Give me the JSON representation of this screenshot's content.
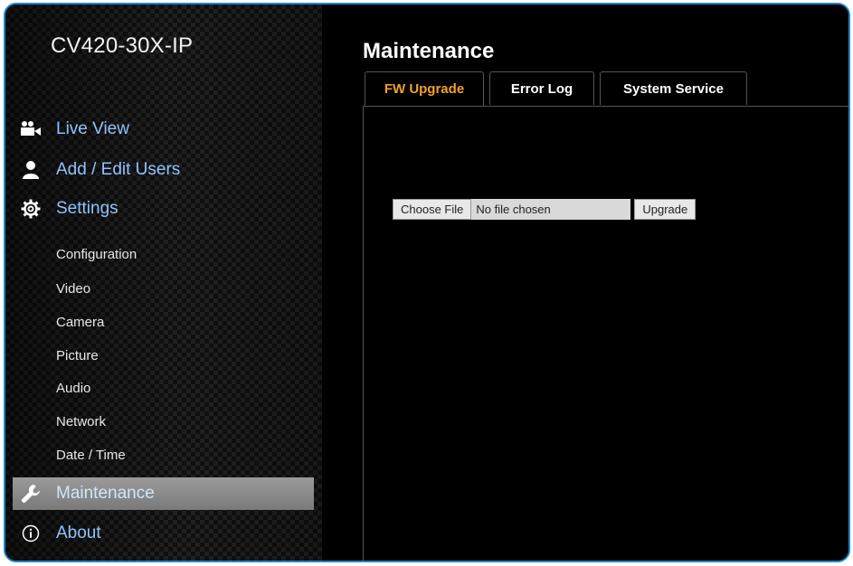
{
  "sidebar": {
    "device_name": "CV420-30X-IP",
    "main_items": [
      {
        "label": "Live View",
        "icon": "video-camera-icon"
      },
      {
        "label": "Add / Edit Users",
        "icon": "user-icon"
      },
      {
        "label": "Settings",
        "icon": "gear-icon"
      },
      {
        "label": "Maintenance",
        "icon": "wrench-icon",
        "active": true
      },
      {
        "label": "About",
        "icon": "info-icon"
      }
    ],
    "settings_items": [
      "Configuration",
      "Video",
      "Camera",
      "Picture",
      "Audio",
      "Network",
      "Date / Time"
    ]
  },
  "main": {
    "title": "Maintenance",
    "tabs": [
      {
        "label": "FW Upgrade",
        "active": true
      },
      {
        "label": "Error Log"
      },
      {
        "label": "System Service"
      }
    ],
    "fw_upgrade": {
      "choose_file_label": "Choose File",
      "file_status": "No file chosen",
      "upgrade_label": "Upgrade"
    }
  },
  "colors": {
    "nav_text": "#8fc3ff",
    "active_tab_text": "#f4a02a",
    "frame_border": "#1f86c9",
    "active_nav_bg": "#8a8a8a"
  }
}
